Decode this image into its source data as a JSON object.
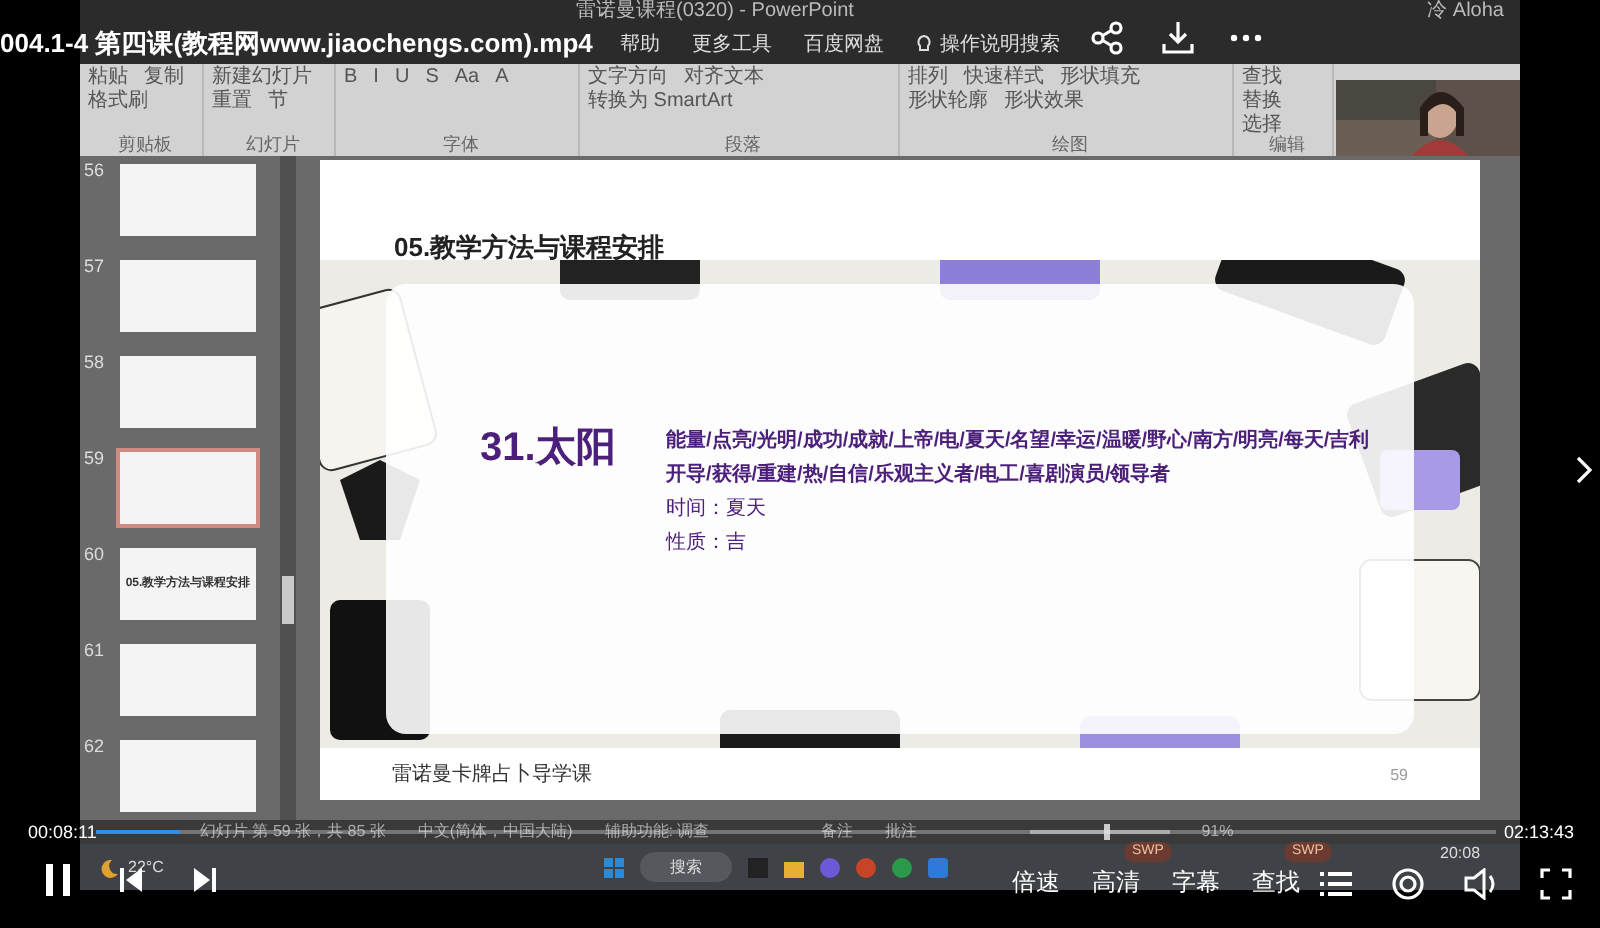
{
  "video": {
    "title": "004.1-4 第四课(教程网www.jiaochengs.com).mp4",
    "elapsed": "00:08:11",
    "duration": "02:13:43",
    "level": 0.06,
    "playing": true
  },
  "window": {
    "title": "雷诺曼课程(0320)  -  PowerPoint",
    "user": "冷 Aloha"
  },
  "menu_tabs": [
    {
      "label": "帮助"
    },
    {
      "label": "更多工具"
    },
    {
      "label": "百度网盘"
    }
  ],
  "tell_me": "操作说明搜索",
  "ribbon": [
    {
      "label": "剪贴板",
      "items": [
        "粘贴",
        "复制",
        "格式刷"
      ]
    },
    {
      "label": "幻灯片",
      "items": [
        "新建幻灯片",
        "重置",
        "节"
      ]
    },
    {
      "label": "字体",
      "items": [
        "B",
        "I",
        "U",
        "S",
        "Aa",
        "A"
      ]
    },
    {
      "label": "段落",
      "items": [
        "文字方向",
        "对齐文本",
        "转换为 SmartArt"
      ]
    },
    {
      "label": "绘图",
      "items": [
        "排列",
        "快速样式",
        "形状填充",
        "形状轮廓",
        "形状效果"
      ]
    },
    {
      "label": "编辑",
      "items": [
        "查找",
        "替换",
        "选择"
      ]
    }
  ],
  "thumbnails": [
    {
      "number": "56",
      "selected": false
    },
    {
      "number": "57",
      "selected": false
    },
    {
      "number": "58",
      "selected": false
    },
    {
      "number": "59",
      "selected": true
    },
    {
      "number": "60",
      "selected": false,
      "text": "05.教学方法与课程安排"
    },
    {
      "number": "61",
      "selected": false
    },
    {
      "number": "62",
      "selected": false
    }
  ],
  "slide": {
    "heading": "05.教学方法与课程安排",
    "title": "31.太阳",
    "keyword_lines": [
      "能量/点亮/光明/成功/成就/上帝/电/夏天/名望/幸运/温暖/野心/南方/明亮/每天/吉利",
      "开导/获得/重建/热/自信/乐观主义者/电工/喜剧演员/领导者"
    ],
    "details": [
      "时间：夏天",
      "性质：吉"
    ],
    "footer": "雷诺曼卡牌占卜导学课",
    "page_number": "59"
  },
  "status_bar": {
    "slide_info": "幻灯片 第 59 张，共 85 张",
    "language": "中文(简体，中国大陆)",
    "accessibility": "辅助功能: 调查",
    "notes": "备注",
    "comments": "批注",
    "zoom": "91%",
    "zoom_slider": {
      "level": 0.55
    }
  },
  "taskbar": {
    "temperature": "22°C",
    "search": "搜索",
    "time": "20:08"
  },
  "player_buttons": [
    {
      "label": "倍速"
    },
    {
      "label": "高清",
      "badge": "SWP"
    },
    {
      "label": "字幕"
    },
    {
      "label": "查找",
      "badge": "SWP"
    }
  ]
}
